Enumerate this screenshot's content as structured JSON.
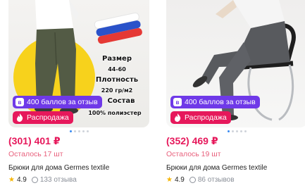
{
  "colors": {
    "price": "#e6185b",
    "points_badge": "#6f39e8",
    "sale_badge": "#e6185b",
    "stock": "#e8607c",
    "star": "#f6b500"
  },
  "products": [
    {
      "image_text": {
        "size_label": "Размер",
        "size_value": "44-60",
        "density_label": "Плотность",
        "density_value": "220 гр/м2",
        "composition_label": "Состав",
        "composition_value": "100% полиэстер"
      },
      "points_badge": "400 баллов за отзыв",
      "sale_badge": "Распродажа",
      "price": "(301) 401 ₽",
      "stock": "Осталось 17 шт",
      "title": "Брюки для дома Germes textile",
      "rating": "4.9",
      "reviews": "133 отзыва",
      "icons": {
        "points": "vk-points-icon",
        "sale": "flame-icon",
        "star": "star-icon"
      }
    },
    {
      "points_badge": "400 баллов за отзыв",
      "sale_badge": "Распродажа",
      "price": "(352) 469 ₽",
      "stock": "Осталось 19 шт",
      "title": "Брюки для дома Germes textile",
      "rating": "4.9",
      "reviews": "86 отзывов",
      "icons": {
        "points": "vk-points-icon",
        "sale": "flame-icon",
        "star": "star-icon"
      }
    }
  ]
}
